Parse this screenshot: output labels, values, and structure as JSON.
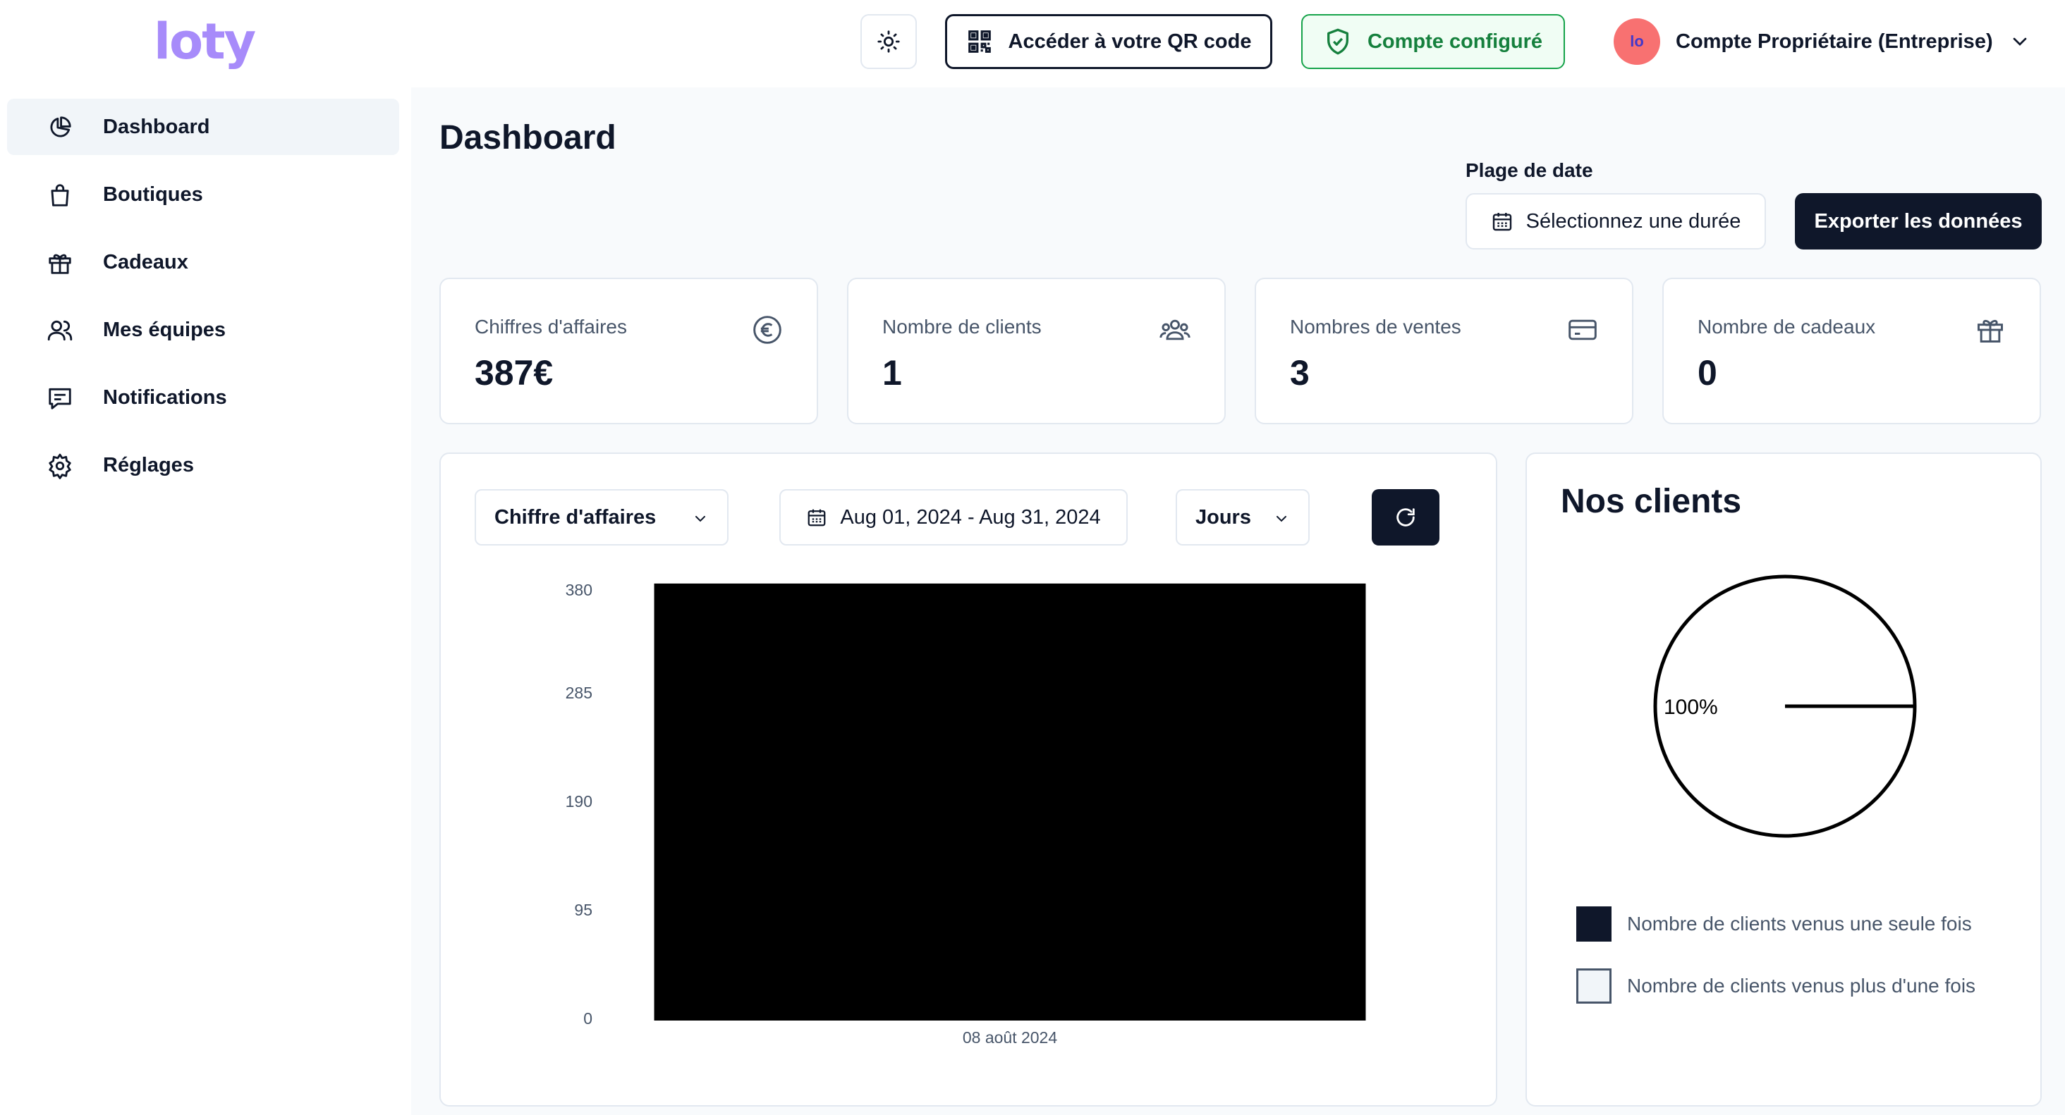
{
  "header": {
    "logo": "loty",
    "qr_label": "Accéder à votre QR code",
    "account_status": "Compte configuré",
    "avatar_initials": "lo",
    "profile_name": "Compte Propriétaire (Entreprise)"
  },
  "sidebar": {
    "items": [
      {
        "label": "Dashboard",
        "icon": "pie-chart-icon",
        "active": true
      },
      {
        "label": "Boutiques",
        "icon": "shopping-bag-icon"
      },
      {
        "label": "Cadeaux",
        "icon": "gift-icon"
      },
      {
        "label": "Mes équipes",
        "icon": "users-icon"
      },
      {
        "label": "Notifications",
        "icon": "message-icon"
      },
      {
        "label": "Réglages",
        "icon": "gear-icon"
      }
    ]
  },
  "main": {
    "title": "Dashboard",
    "date_range_label": "Plage de date",
    "date_range_placeholder": "Sélectionnez une durée",
    "export_label": "Exporter les données",
    "stats": [
      {
        "label": "Chiffres d'affaires",
        "value": "387€",
        "icon": "euro-icon"
      },
      {
        "label": "Nombre de clients",
        "value": "1",
        "icon": "users-icon"
      },
      {
        "label": "Nombres de ventes",
        "value": "3",
        "icon": "credit-card-icon"
      },
      {
        "label": "Nombre de cadeaux",
        "value": "0",
        "icon": "gift-icon"
      }
    ],
    "chart_controls": {
      "metric": "Chiffre d'affaires",
      "range": "Aug 01, 2024 - Aug 31, 2024",
      "unit": "Jours"
    },
    "clients_title": "Nos clients"
  },
  "colors": {
    "brand": "#a78bfa",
    "dark": "#0f172a",
    "success": "#15803d"
  },
  "chart_data": [
    {
      "type": "bar",
      "categories": [
        "08 août 2024"
      ],
      "values": [
        387
      ],
      "yticks": [
        "380",
        "285",
        "190",
        "95",
        "0"
      ],
      "ylim": [
        0,
        380
      ],
      "bar_color": "#000000",
      "grid": false
    },
    {
      "type": "pie",
      "title": "",
      "labels": [
        "Nombre de clients venus une seule fois",
        "Nombre de clients venus plus d'une fois"
      ],
      "values": [
        100,
        0
      ],
      "data_labels": [
        "100%"
      ],
      "colors": [
        "#0f172a",
        "#f1f5f9"
      ],
      "legend_position": "bottom"
    }
  ]
}
